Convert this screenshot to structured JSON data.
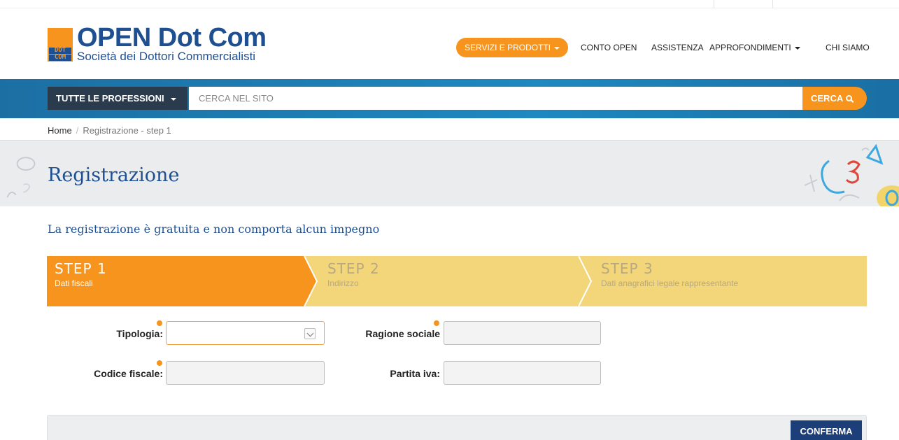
{
  "logo": {
    "mark_line1": "DOT",
    "mark_line2": "COM",
    "title": "OPEN Dot Com",
    "subtitle": "Società dei Dottori Commercialisti"
  },
  "nav": {
    "servizi": "SERVIZI E PRODOTTI",
    "conto": "CONTO OPEN",
    "assistenza": "ASSISTENZA",
    "approfondimenti": "APPROFONDIMENTI",
    "chi_siamo": "CHI SIAMO"
  },
  "search": {
    "professions": "TUTTE LE PROFESSIONI",
    "placeholder": "CERCA NEL SITO",
    "button": "CERCA"
  },
  "breadcrumb": {
    "home": "Home",
    "separator": "/",
    "current": "Registrazione - step 1"
  },
  "page": {
    "title": "Registrazione",
    "intro": "La registrazione è gratuita e non comporta alcun impegno"
  },
  "steps": [
    {
      "label": "STEP 1",
      "sub": "Dati fiscali",
      "active": true
    },
    {
      "label": "STEP 2",
      "sub": "Indirizzo",
      "active": false
    },
    {
      "label": "STEP 3",
      "sub": "Dati anagrafici legale rappresentante",
      "active": false
    }
  ],
  "form": {
    "tipologia": {
      "label": "Tipologia:",
      "value": ""
    },
    "ragione_sociale": {
      "label": "Ragione sociale",
      "value": ""
    },
    "codice_fiscale": {
      "label": "Codice fiscale:",
      "value": ""
    },
    "partita_iva": {
      "label": "Partita iva:",
      "value": ""
    }
  },
  "actions": {
    "confirm": "CONFERMA"
  },
  "colors": {
    "brand_blue": "#1d4f91",
    "accent_orange": "#f7941d",
    "step_active": "#f7941d",
    "step_inactive": "#f3d67a",
    "confirm_bg": "#1c3f7a"
  }
}
